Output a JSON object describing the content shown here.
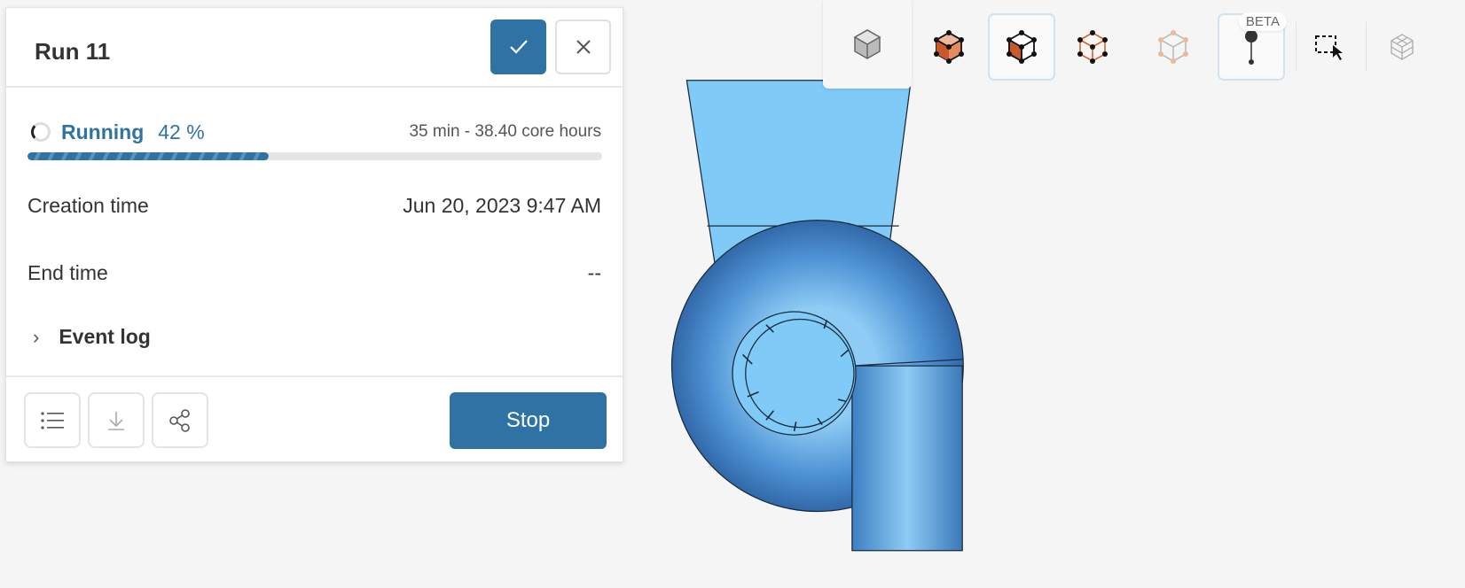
{
  "run": {
    "title": "Run 11",
    "status": "Running",
    "progress_label": "42 %",
    "progress": 0.42,
    "meta": "35 min - 38.40 core hours",
    "creation_label": "Creation time",
    "creation_value": "Jun 20, 2023 9:47 AM",
    "end_label": "End time",
    "end_value": "--",
    "event_log": "Event log",
    "stop": "Stop"
  },
  "toolbar": {
    "beta": "BETA",
    "icons": [
      "solid-cube-icon",
      "faces-vertices-icon",
      "edges-faces-icon",
      "wireframe-vertices-icon",
      "transparent-cube-icon",
      "probe-point-icon",
      "box-select-icon",
      "mesh-cube-icon"
    ]
  },
  "colors": {
    "accent": "#2f73a5",
    "orange": "#d9622b",
    "model": "#6fb0e8"
  }
}
